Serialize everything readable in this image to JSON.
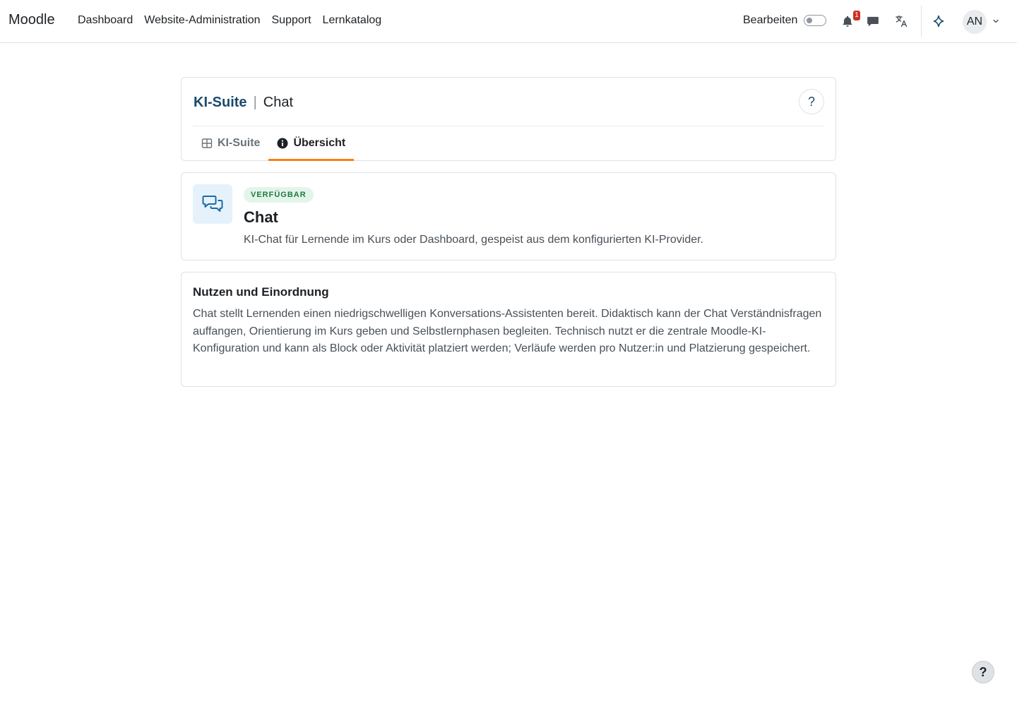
{
  "navbar": {
    "brand": "Moodle",
    "items": [
      {
        "label": "Dashboard"
      },
      {
        "label": "Website-Administration"
      },
      {
        "label": "Support"
      },
      {
        "label": "Lernkatalog"
      }
    ],
    "edit_label": "Bearbeiten",
    "edit_mode_on": false,
    "notification_count": "1",
    "avatar_initials": "AN"
  },
  "header": {
    "breadcrumb_root": "KI-Suite",
    "breadcrumb_separator": "|",
    "breadcrumb_current": "Chat",
    "help_label": "?",
    "tabs": [
      {
        "label": "KI-Suite",
        "icon": "grid-icon",
        "active": false
      },
      {
        "label": "Übersicht",
        "icon": "info-icon",
        "active": true
      }
    ]
  },
  "feature": {
    "icon": "chat-bubbles-icon",
    "status": "VERFÜGBAR",
    "title": "Chat",
    "description": "KI-Chat für Lernende im Kurs oder Dashboard, gespeist aus dem konfigurierten KI-Provider."
  },
  "info": {
    "title": "Nutzen und Einordnung",
    "text": "Chat stellt Lernenden einen niedrigschwelligen Konversations-Assistenten bereit. Didaktisch kann der Chat Verständnisfragen auffangen, Orientierung im Kurs geben und Selbstlernphasen begleiten. Technisch nutzt er die zentrale Moodle-KI-Konfiguration und kann als Block oder Aktivität platziert werden; Verläufe werden pro Nutzer:in und Platzierung gespeichert."
  },
  "footer": {
    "help_label": "?"
  },
  "colors": {
    "accent": "#f98012",
    "brand_blue": "#1b4a6b",
    "badge_red": "#ca3120",
    "status_green": "#1f7a3f"
  }
}
